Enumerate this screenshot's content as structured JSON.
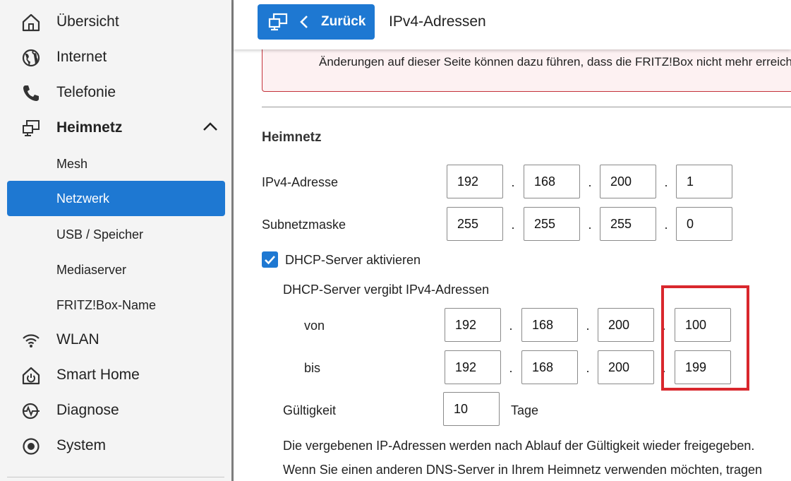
{
  "sidebar": {
    "items": [
      {
        "label": "Übersicht",
        "icon": "home-icon"
      },
      {
        "label": "Internet",
        "icon": "globe-icon"
      },
      {
        "label": "Telefonie",
        "icon": "phone-icon"
      },
      {
        "label": "Heimnetz",
        "icon": "network-icon"
      },
      {
        "label": "WLAN",
        "icon": "wifi-icon"
      },
      {
        "label": "Smart Home",
        "icon": "smart-home-icon"
      },
      {
        "label": "Diagnose",
        "icon": "diagnose-icon"
      },
      {
        "label": "System",
        "icon": "system-icon"
      }
    ],
    "heimnetz_sub": [
      {
        "label": "Mesh"
      },
      {
        "label": "Netzwerk",
        "active": true
      },
      {
        "label": "USB / Speicher"
      },
      {
        "label": "Mediaserver"
      },
      {
        "label": "FRITZ!Box-Name"
      }
    ]
  },
  "topbar": {
    "back_label": "Zurück",
    "title": "IPv4-Adressen"
  },
  "warning": {
    "text": "Änderungen auf dieser Seite können dazu führen, dass die FRITZ!Box nicht mehr erreichbar ist."
  },
  "form": {
    "section_title": "Heimnetz",
    "ipv4_label": "IPv4-Adresse",
    "ipv4": [
      "192",
      "168",
      "200",
      "1"
    ],
    "subnet_label": "Subnetzmaske",
    "subnet": [
      "255",
      "255",
      "255",
      "0"
    ],
    "dhcp_label": "DHCP-Server aktivieren",
    "dhcp_checked": true,
    "dhcp_range_label": "DHCP-Server vergibt IPv4-Adressen",
    "from_label": "von",
    "from": [
      "192",
      "168",
      "200",
      "100"
    ],
    "to_label": "bis",
    "to": [
      "192",
      "168",
      "200",
      "199"
    ],
    "validity_label": "Gültigkeit",
    "validity_value": "10",
    "validity_unit": "Tage",
    "info1": "Die vergebenen IP-Adressen werden nach Ablauf der Gültigkeit wieder freigegeben.",
    "info2": "Wenn Sie einen anderen DNS-Server in Ihrem Heimnetz verwenden möchten, tragen"
  },
  "colors": {
    "accent": "#1e78d2",
    "highlight": "#d9272d",
    "warning_border": "#c4323a"
  }
}
